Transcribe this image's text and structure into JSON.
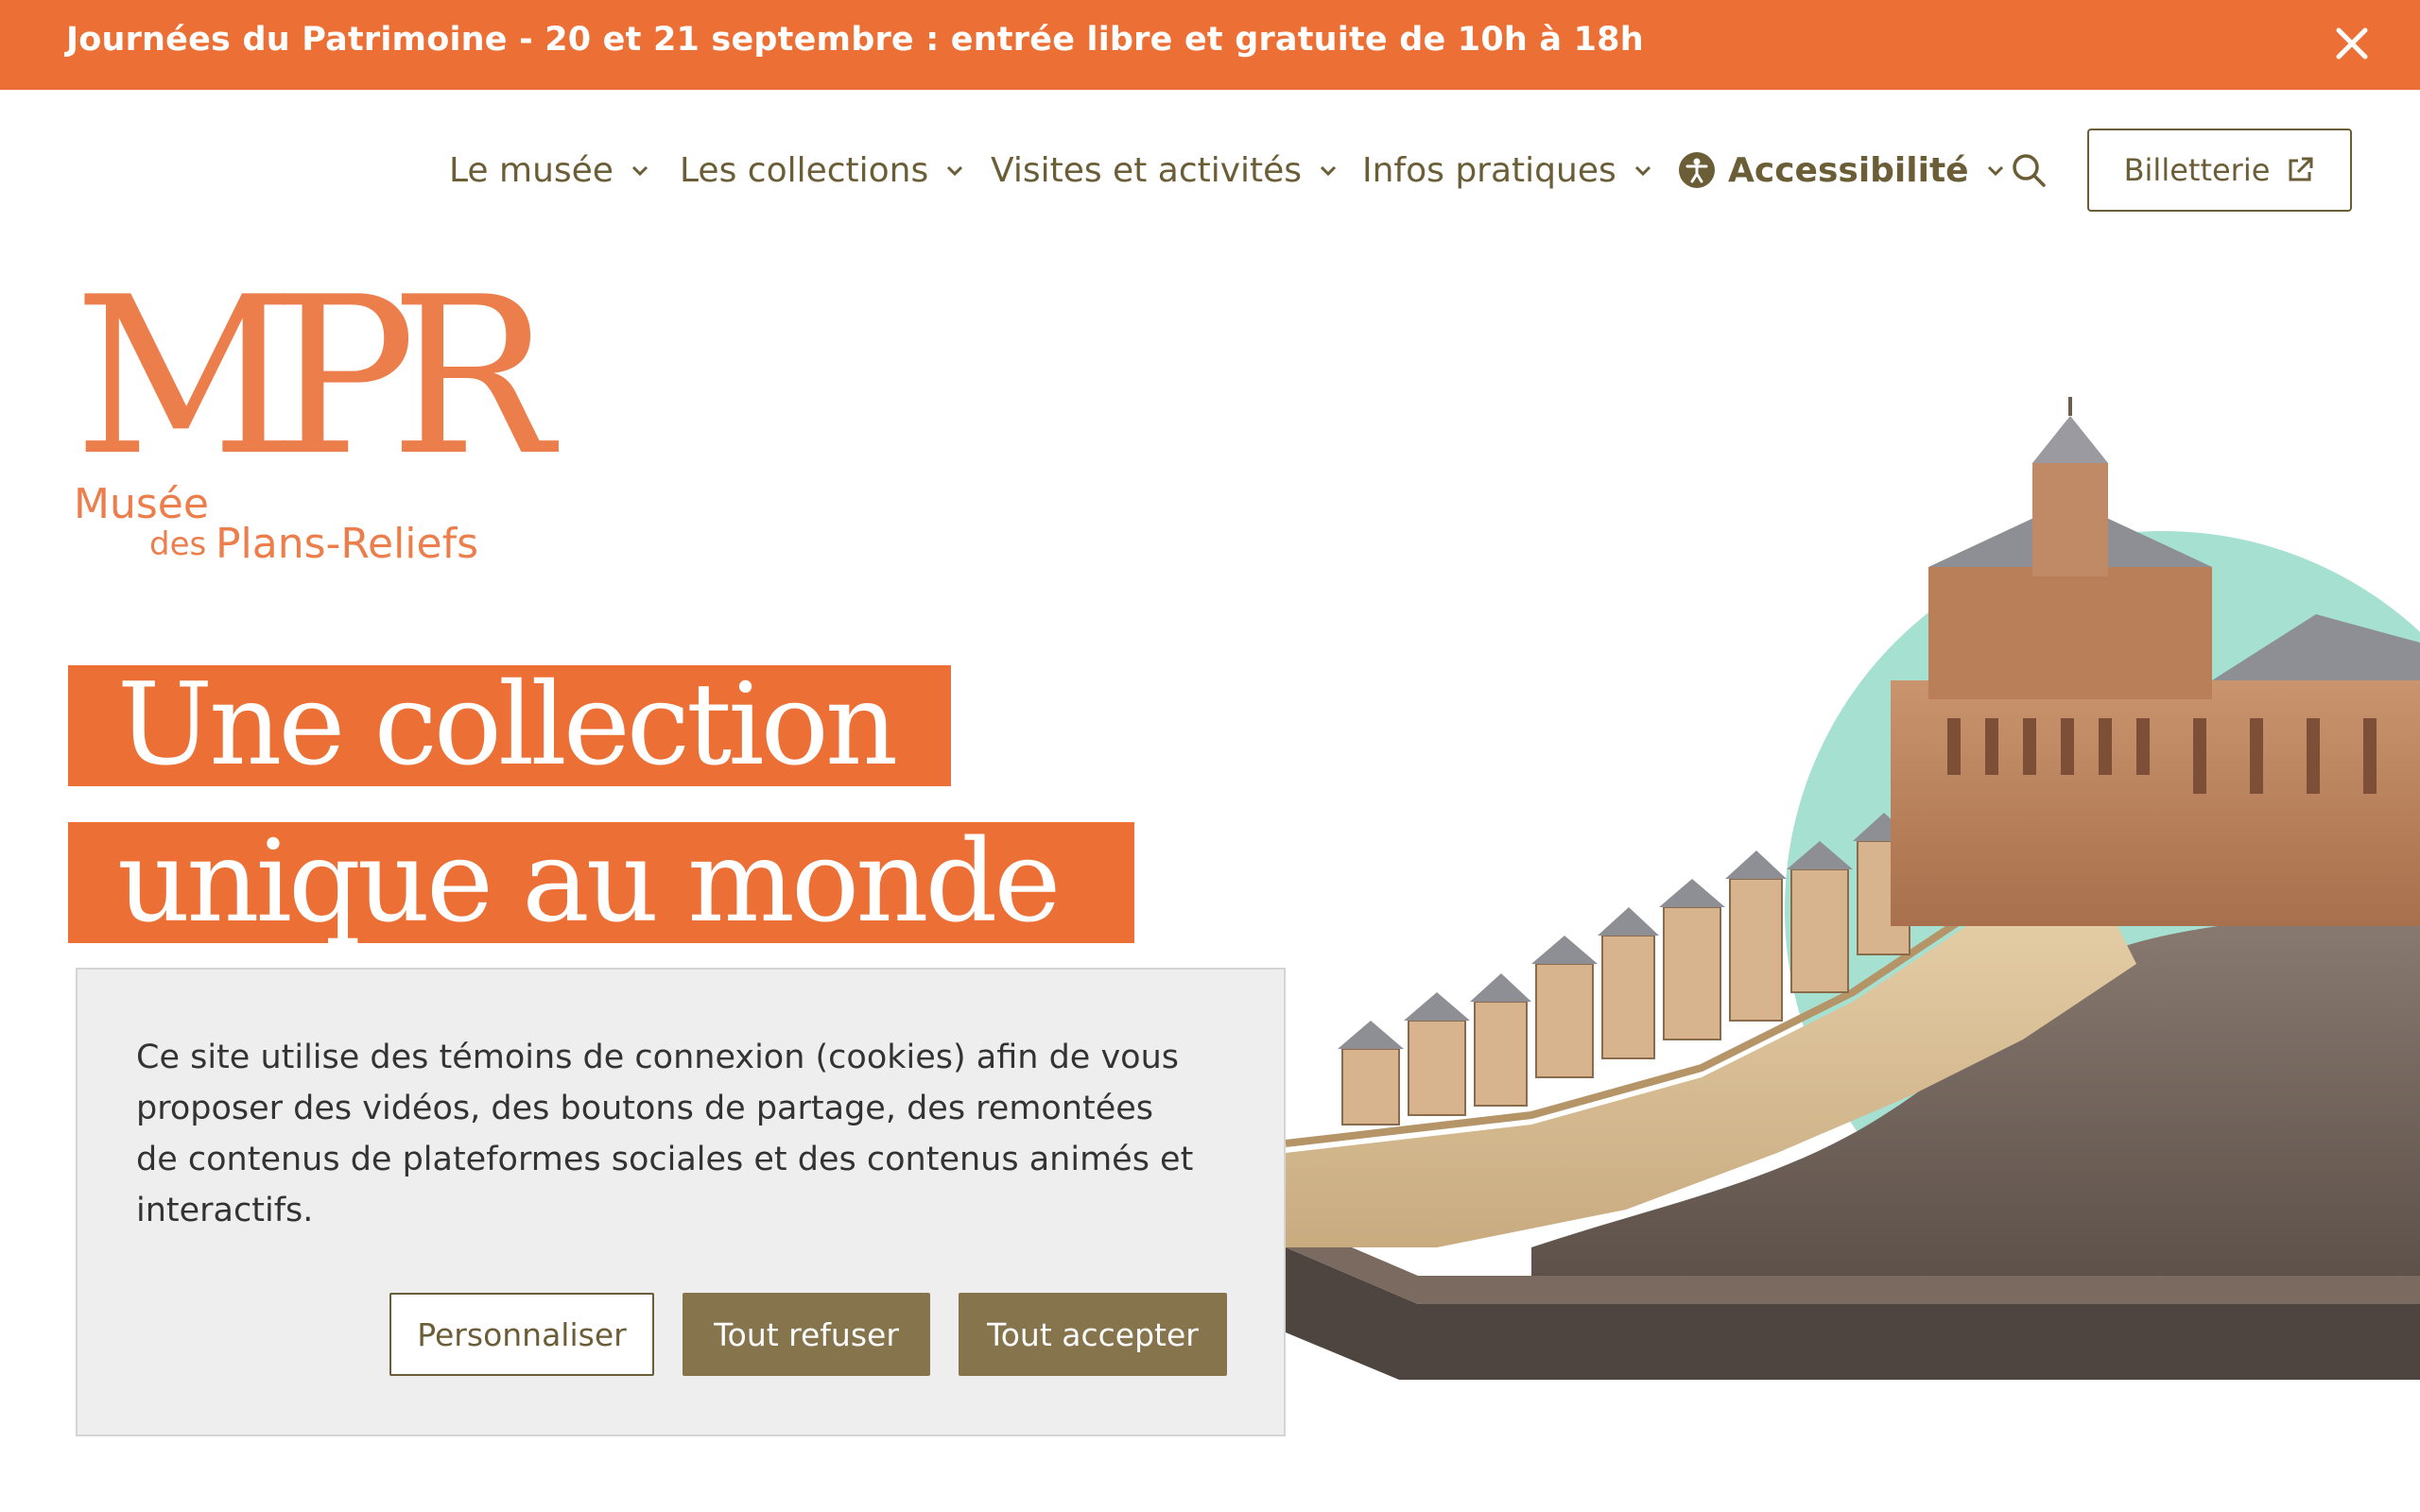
{
  "banner": {
    "text": "Journées du Patrimoine - 20 et 21 septembre : entrée libre et gratuite de 10h à 18h",
    "close_icon": "close-icon",
    "background": "#ec7035"
  },
  "nav": {
    "items": [
      {
        "label": "Le musée"
      },
      {
        "label": "Les collections"
      },
      {
        "label": "Visites et activités"
      },
      {
        "label": "Infos pratiques"
      },
      {
        "label": "Accessibilité",
        "icon": "accessibility-icon"
      }
    ],
    "search_icon": "search-icon",
    "ticket_label": "Billetterie",
    "ticket_icon": "external-link-icon"
  },
  "logo": {
    "monogram": "MPR",
    "line1": "Musée",
    "line2_small": "des",
    "line2": "Plans-Reliefs"
  },
  "hero": {
    "headline_line1": "Une collection",
    "headline_line2": "unique au monde"
  },
  "cookie": {
    "text": "Ce site utilise des témoins de connexion (cookies) afin de vous proposer des vidéos, des boutons de partage, des remontées de contenus de plateformes sociales et des contenus animés et interactifs.",
    "customize_label": "Personnaliser",
    "refuse_label": "Tout refuser",
    "accept_label": "Tout accepter"
  },
  "colors": {
    "accent": "#ec7035",
    "brand_text": "#6b5d36",
    "button": "#85744c",
    "mint_circle": "#a5e0d0"
  }
}
